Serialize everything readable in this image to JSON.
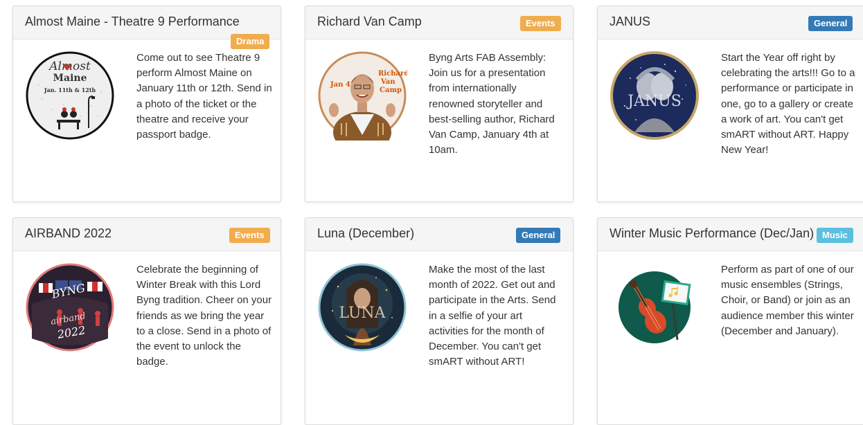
{
  "cards": [
    {
      "title": "Almost Maine - Theatre 9 Performance",
      "badge": "Drama",
      "badge_color": "#f0ad4e",
      "image_text": {
        "line1": "Almost",
        "line2": "Maine",
        "line3": "Jan. 11th & 12th"
      },
      "description": "Come out to see Theatre 9 perform Almost Maine on January 11th or 12th. Send in a photo of the ticket or the theatre and receive your passport badge."
    },
    {
      "title": "Richard Van Camp",
      "badge": "Events",
      "badge_color": "#f0ad4e",
      "image_text": {
        "left": "Jan 4",
        "right_line1": "Richard",
        "right_line2": "Van",
        "right_line3": "Camp"
      },
      "description": "Byng Arts FAB Assembly: Join us for a presentation from internationally renowned storyteller and best-selling author, Richard Van Camp, January 4th at 10am."
    },
    {
      "title": "JANUS",
      "badge": "General",
      "badge_color": "#337ab7",
      "image_text": {
        "word": "JANUS"
      },
      "description": "Start the Year off right by celebrating the arts!!! Go to a performance or participate in one, go to a gallery or create a work of art. You can't get smART without ART. Happy New Year!"
    },
    {
      "title": "AIRBAND 2022",
      "badge": "Events",
      "badge_color": "#f0ad4e",
      "image_text": {
        "line1": "BYNG",
        "line2": "airband",
        "line3": "2022"
      },
      "description": "Celebrate the beginning of Winter Break with this Lord Byng tradition. Cheer on your friends as we bring the year to a close. Send in a photo of the event to unlock the badge."
    },
    {
      "title": "Luna (December)",
      "badge": "General",
      "badge_color": "#337ab7",
      "image_text": {
        "word": "LUNA"
      },
      "description": "Make the most of the last month of 2022. Get out and participate in the Arts. Send in a selfie of your art activities for the month of December. You can't get smART without ART!"
    },
    {
      "title": "Winter Music Performance (Dec/Jan)",
      "badge": "Music",
      "badge_color": "#5bc0de",
      "image_text": {},
      "description": "Perform as part of one of our music ensembles (Strings, Choir, or Band) or join as an audience member this winter (December and January)."
    }
  ]
}
